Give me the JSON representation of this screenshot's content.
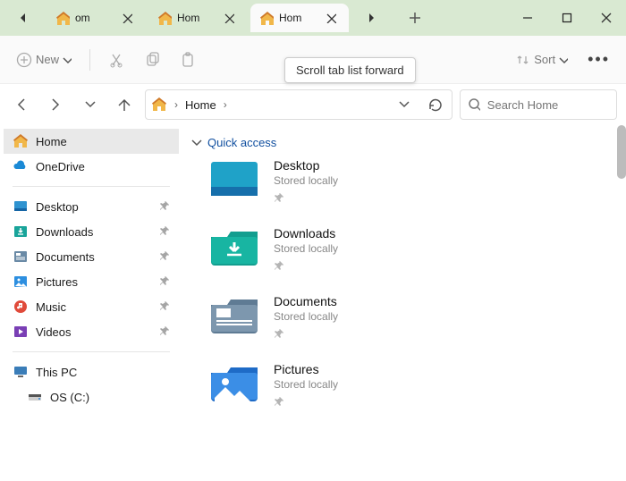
{
  "tabs": [
    {
      "label": "om"
    },
    {
      "label": "Hom"
    },
    {
      "label": "Hom"
    }
  ],
  "tooltip": "Scroll tab list forward",
  "toolbar": {
    "new_label": "New",
    "sort_label": "Sort"
  },
  "addr": {
    "home": "Home"
  },
  "search": {
    "placeholder": "Search Home"
  },
  "sidebar": {
    "home": "Home",
    "onedrive": "OneDrive",
    "desktop": "Desktop",
    "downloads": "Downloads",
    "documents": "Documents",
    "pictures": "Pictures",
    "music": "Music",
    "videos": "Videos",
    "thispc": "This PC",
    "osc": "OS (C:)"
  },
  "section": {
    "quick_access": "Quick access"
  },
  "items": [
    {
      "name": "Desktop",
      "sub": "Stored locally"
    },
    {
      "name": "Downloads",
      "sub": "Stored locally"
    },
    {
      "name": "Documents",
      "sub": "Stored locally"
    },
    {
      "name": "Pictures",
      "sub": "Stored locally"
    }
  ]
}
